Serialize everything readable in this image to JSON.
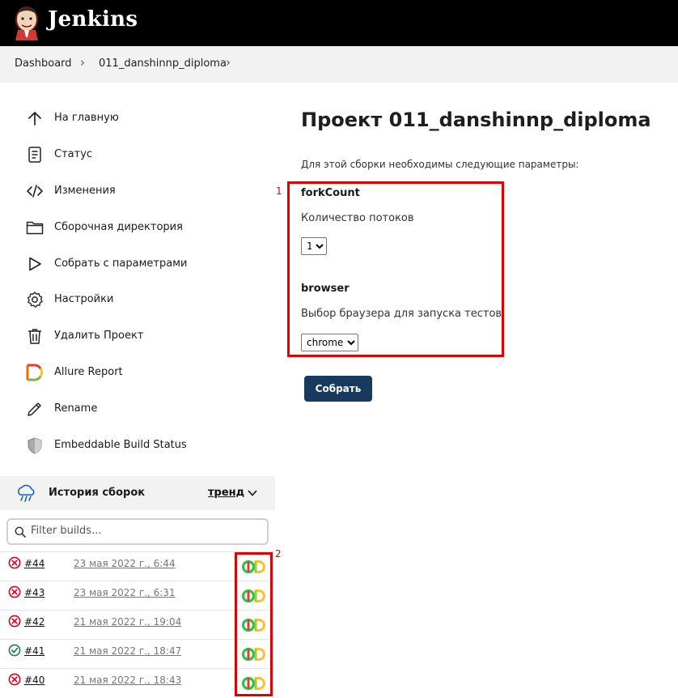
{
  "header": {
    "app_title": "Jenkins"
  },
  "breadcrumbs": [
    "Dashboard",
    "011_danshinnp_diploma"
  ],
  "sidebar": {
    "items": [
      {
        "label": "На главную",
        "icon": "arrow-up-icon"
      },
      {
        "label": "Статус",
        "icon": "document-icon"
      },
      {
        "label": "Изменения",
        "icon": "code-icon"
      },
      {
        "label": "Сборочная директория",
        "icon": "folder-icon"
      },
      {
        "label": "Собрать с параметрами",
        "icon": "play-icon"
      },
      {
        "label": "Настройки",
        "icon": "gear-icon"
      },
      {
        "label": "Удалить Проект",
        "icon": "trash-icon"
      },
      {
        "label": "Allure Report",
        "icon": "allure-icon"
      },
      {
        "label": "Rename",
        "icon": "pencil-icon"
      },
      {
        "label": "Embeddable Build Status",
        "icon": "shield-icon"
      }
    ]
  },
  "history": {
    "title": "История сборок",
    "trend_label": "тренд",
    "filter_placeholder": "Filter builds...",
    "builds": [
      {
        "number": "#44",
        "date": "23 мая 2022 г., 6:44",
        "status": "failed"
      },
      {
        "number": "#43",
        "date": "23 мая 2022 г., 6:31",
        "status": "failed"
      },
      {
        "number": "#42",
        "date": "21 мая 2022 г., 19:04",
        "status": "failed"
      },
      {
        "number": "#41",
        "date": "21 мая 2022 г., 18:47",
        "status": "success"
      },
      {
        "number": "#40",
        "date": "21 мая 2022 г., 18:43",
        "status": "failed"
      }
    ]
  },
  "main": {
    "title": "Проект 011_danshinnp_diploma",
    "description": "Для этой сборки необходимы следующие параметры:",
    "params": [
      {
        "name": "forkCount",
        "hint": "Количество потоков",
        "value": "1"
      },
      {
        "name": "browser",
        "hint": "Выбор браузера для запуска тестов",
        "value": "chrome"
      }
    ],
    "build_button": "Собрать"
  },
  "annotations": {
    "box1": "1",
    "box2": "2"
  },
  "colors": {
    "accent": "#173a5e",
    "annotation": "#e00000",
    "failed": "#d9001b",
    "success": "#138347"
  }
}
